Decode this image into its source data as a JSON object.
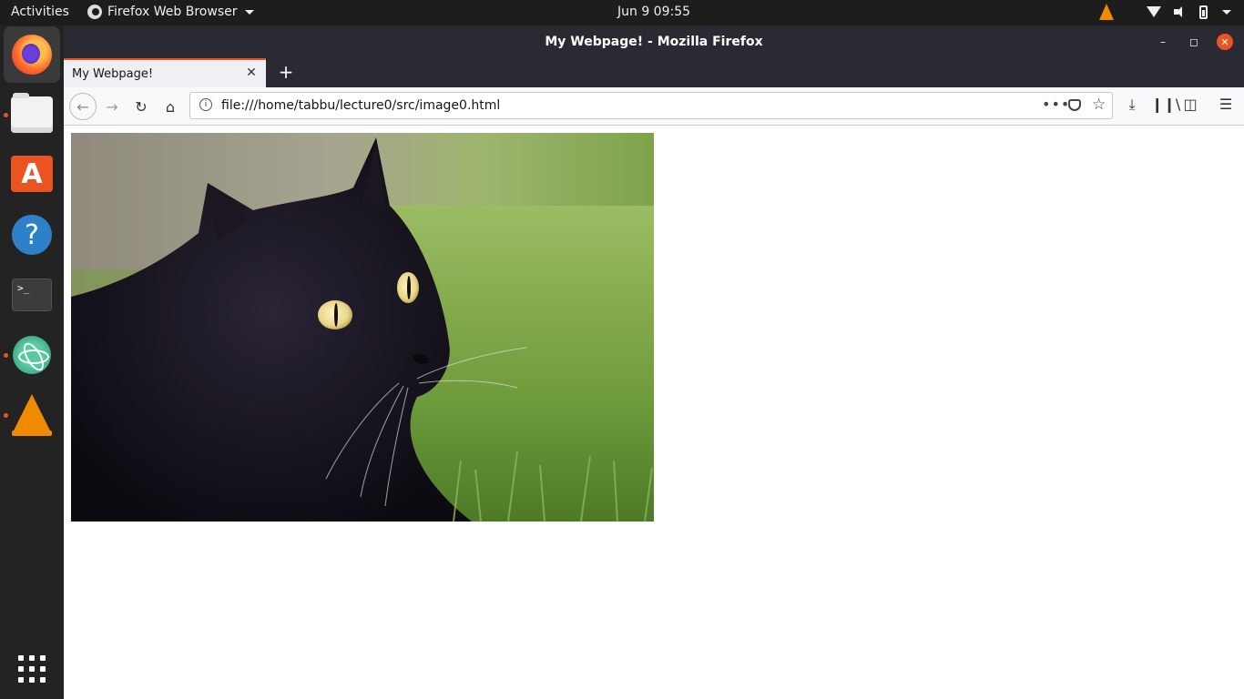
{
  "topbar": {
    "activities": "Activities",
    "app_name": "Firefox Web Browser",
    "clock": "Jun 9  09:55"
  },
  "dock": {
    "items": [
      "firefox",
      "files",
      "ubuntu-software",
      "help",
      "terminal",
      "atom",
      "vlc"
    ],
    "terminal_prompt": ">_"
  },
  "window": {
    "title": "My Webpage! - Mozilla Firefox"
  },
  "tabs": [
    {
      "label": "My Webpage!",
      "active": true
    }
  ],
  "navbar": {
    "url": "file:///home/tabbu/lecture0/src/image0.html"
  },
  "content": {
    "image": "black cat in grass"
  },
  "colors": {
    "accent": "#e95420",
    "topbar_bg": "#1d1d1d",
    "dock_bg": "#232323",
    "tabstrip_bg": "#2b2a33"
  }
}
